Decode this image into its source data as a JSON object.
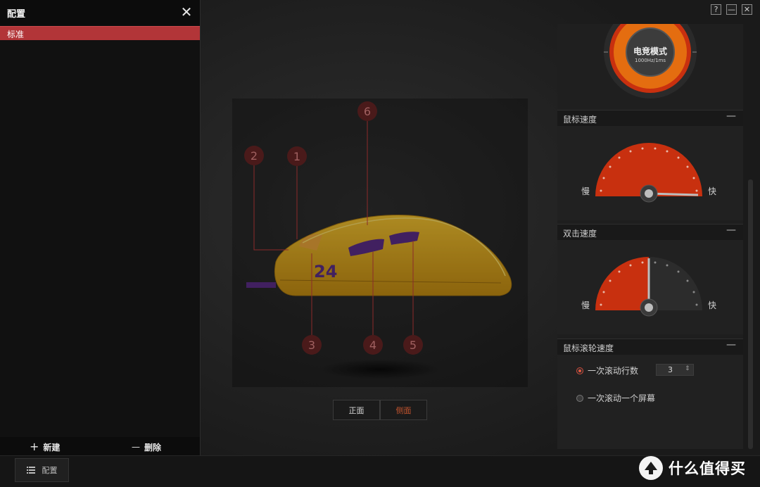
{
  "config_panel": {
    "title": "配置",
    "close_symbol": "✕",
    "profiles": [
      {
        "label": "标准",
        "selected": true
      }
    ],
    "new_label": "新建",
    "delete_label": "删除",
    "new_symbol": "+",
    "delete_symbol": "—"
  },
  "bottom_bar": {
    "config_label": "配置"
  },
  "window_controls": {
    "help": "?",
    "minimize": "—",
    "close": "✕"
  },
  "mouse_view": {
    "button_numbers": [
      "1",
      "2",
      "3",
      "4",
      "5",
      "6"
    ],
    "model_number": "24",
    "view_buttons": [
      {
        "label": "正面",
        "active": false
      },
      {
        "label": "侧面",
        "active": true
      }
    ]
  },
  "report_rate": {
    "mode_label": "电竞模式",
    "mode_sub": "1000Hz/1ms"
  },
  "mouse_speed": {
    "title": "鼠标速度",
    "collapse": "—",
    "slow": "慢",
    "fast": "快",
    "level": 0.97
  },
  "double_click_speed": {
    "title": "双击速度",
    "collapse": "—",
    "slow": "慢",
    "fast": "快",
    "level": 0.5
  },
  "wheel_speed": {
    "title": "鼠标滚轮速度",
    "collapse": "—",
    "option_lines": "一次滚动行数",
    "option_screen": "一次滚动一个屏幕",
    "lines_value": "3",
    "stepper_arrows": "⇕",
    "selected": "lines"
  },
  "watermark": {
    "text": "什么值得买",
    "logo_char": "值"
  },
  "colors": {
    "accent": "#b23538",
    "gauge": "#c8300f",
    "mouse_body": "#e0a81c",
    "mouse_buttons": "#5b2d85"
  }
}
